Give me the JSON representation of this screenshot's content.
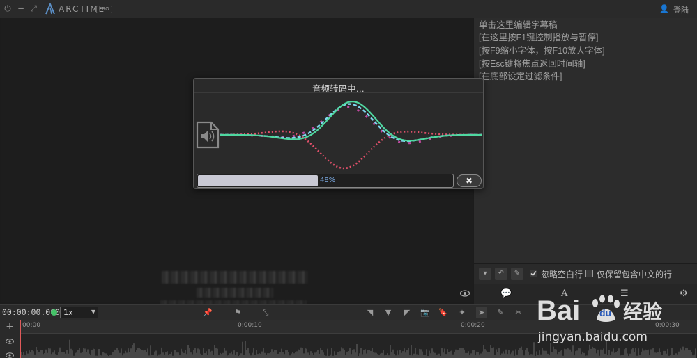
{
  "window": {
    "brand": "ARCTIME",
    "badge": "PRO",
    "login_label": "登陆"
  },
  "subtitle_panel": {
    "hints": [
      "单击这里编辑字幕稿",
      "[在这里按F1键控制播放与暂停]",
      "[按F9缩小字体，按F10放大字体]",
      "[按Esc键将焦点返回时间轴]",
      "[在底部设定过滤条件]"
    ]
  },
  "filters": {
    "ignore_empty_label": "忽略空白行",
    "ignore_empty_checked": true,
    "chinese_only_label": "仅保留包含中文的行",
    "chinese_only_checked": false
  },
  "dialog": {
    "title": "音频转码中…",
    "progress": 48,
    "progress_text": "48%"
  },
  "transport": {
    "timecode": "00:00:00.000",
    "speed": "1x"
  },
  "timeline": {
    "ticks": [
      "00:00",
      "0:00:10",
      "0:00:20",
      "0:00:30"
    ]
  },
  "watermark": {
    "logo_text": "Bai",
    "logo_suffix": "du",
    "cn_text": "经验",
    "url": "jingyan.baidu.com"
  },
  "colors": {
    "accent_green": "#45c268",
    "wave_green": "#4fd8a0",
    "wave_cyan": "#7fd8f0",
    "wave_red": "#e0506a",
    "wave_magenta": "#c04aa0",
    "progress_text": "#7aa8e0"
  }
}
